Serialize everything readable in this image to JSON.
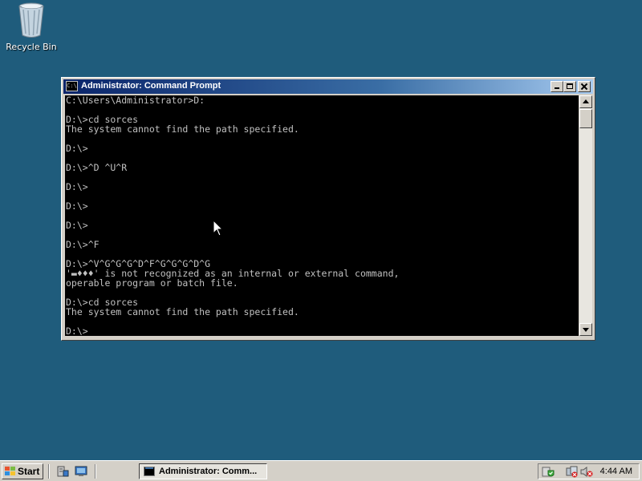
{
  "desktop": {
    "icons": [
      {
        "label": "Recycle Bin",
        "icon": "recycle-bin-icon"
      }
    ],
    "background_color": "#1f5c7c"
  },
  "window": {
    "title": "Administrator: Command Prompt",
    "icon": "command-prompt-icon",
    "controls": [
      "minimize",
      "maximize",
      "close"
    ],
    "console_lines": [
      "C:\\Users\\Administrator>D:",
      "",
      "D:\\>cd sorces",
      "The system cannot find the path specified.",
      "",
      "D:\\>",
      "",
      "D:\\>^D ^U^R",
      "",
      "D:\\>",
      "",
      "D:\\>",
      "",
      "D:\\>",
      "",
      "D:\\>^F",
      "",
      "D:\\>^V^G^G^G^D^F^G^G^G^D^G",
      "'▬♦♦♦' is not recognized as an internal or external command,",
      "operable program or batch file.",
      "",
      "D:\\>cd sorces",
      "The system cannot find the path specified.",
      "",
      "D:\\>"
    ],
    "console_colors": {
      "background": "#000000",
      "text": "#c0c0c0"
    }
  },
  "taskbar": {
    "start_label": "Start",
    "quick_launch": [
      "server-manager-icon",
      "show-desktop-icon"
    ],
    "tasks": [
      {
        "label": "Administrator: Comm...",
        "icon": "command-prompt-icon",
        "active": true
      }
    ],
    "tray_icons": [
      "security-shield-icon",
      "network-disconnected-icon",
      "volume-muted-icon"
    ],
    "clock": "4:44 AM"
  }
}
